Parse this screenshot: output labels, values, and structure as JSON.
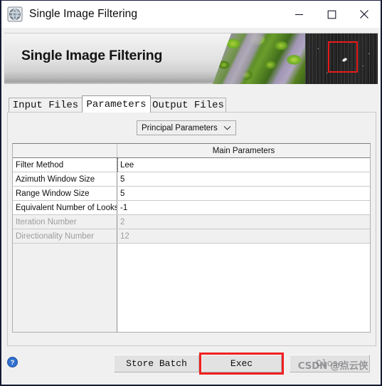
{
  "window": {
    "title": "Single Image Filtering",
    "icon": "globe-icon",
    "controls": {
      "minimize": "minimize-icon",
      "maximize": "maximize-icon",
      "close": "close-icon"
    }
  },
  "banner": {
    "title": "Single Image Filtering",
    "images": {
      "aerial": "aerial-forest-image",
      "sar": "sar-grayscale-image",
      "annotation": "red-box-annotation"
    }
  },
  "tabs": [
    {
      "label": "Input Files",
      "active": false
    },
    {
      "label": "Parameters",
      "active": true
    },
    {
      "label": "Output Files",
      "active": false
    }
  ],
  "parameter_set": {
    "selected": "Principal Parameters",
    "arrow": "chevron-down-icon"
  },
  "table": {
    "headers": [
      "",
      "Main Parameters"
    ],
    "rows": [
      {
        "name": "Filter Method",
        "value": "Lee",
        "enabled": true,
        "focused": true
      },
      {
        "name": "Azimuth Window Size",
        "value": "5",
        "enabled": true,
        "focused": false
      },
      {
        "name": "Range Window Size",
        "value": "5",
        "enabled": true,
        "focused": false
      },
      {
        "name": "Equivalent Number of Looks",
        "value": "-1",
        "enabled": true,
        "focused": false
      },
      {
        "name": "Iteration Number",
        "value": "2",
        "enabled": false,
        "focused": false
      },
      {
        "name": "Directionality Number",
        "value": "12",
        "enabled": false,
        "focused": false
      }
    ]
  },
  "footer": {
    "help": "help-icon",
    "store_batch_label": "Store Batch",
    "exec_label": "Exec",
    "close_label": "Close",
    "watermark": "CSDN @点云侠"
  },
  "colors": {
    "accent_red": "#f02020",
    "help_blue": "#2f6fd0",
    "disabled_text": "#9c9c9c"
  }
}
